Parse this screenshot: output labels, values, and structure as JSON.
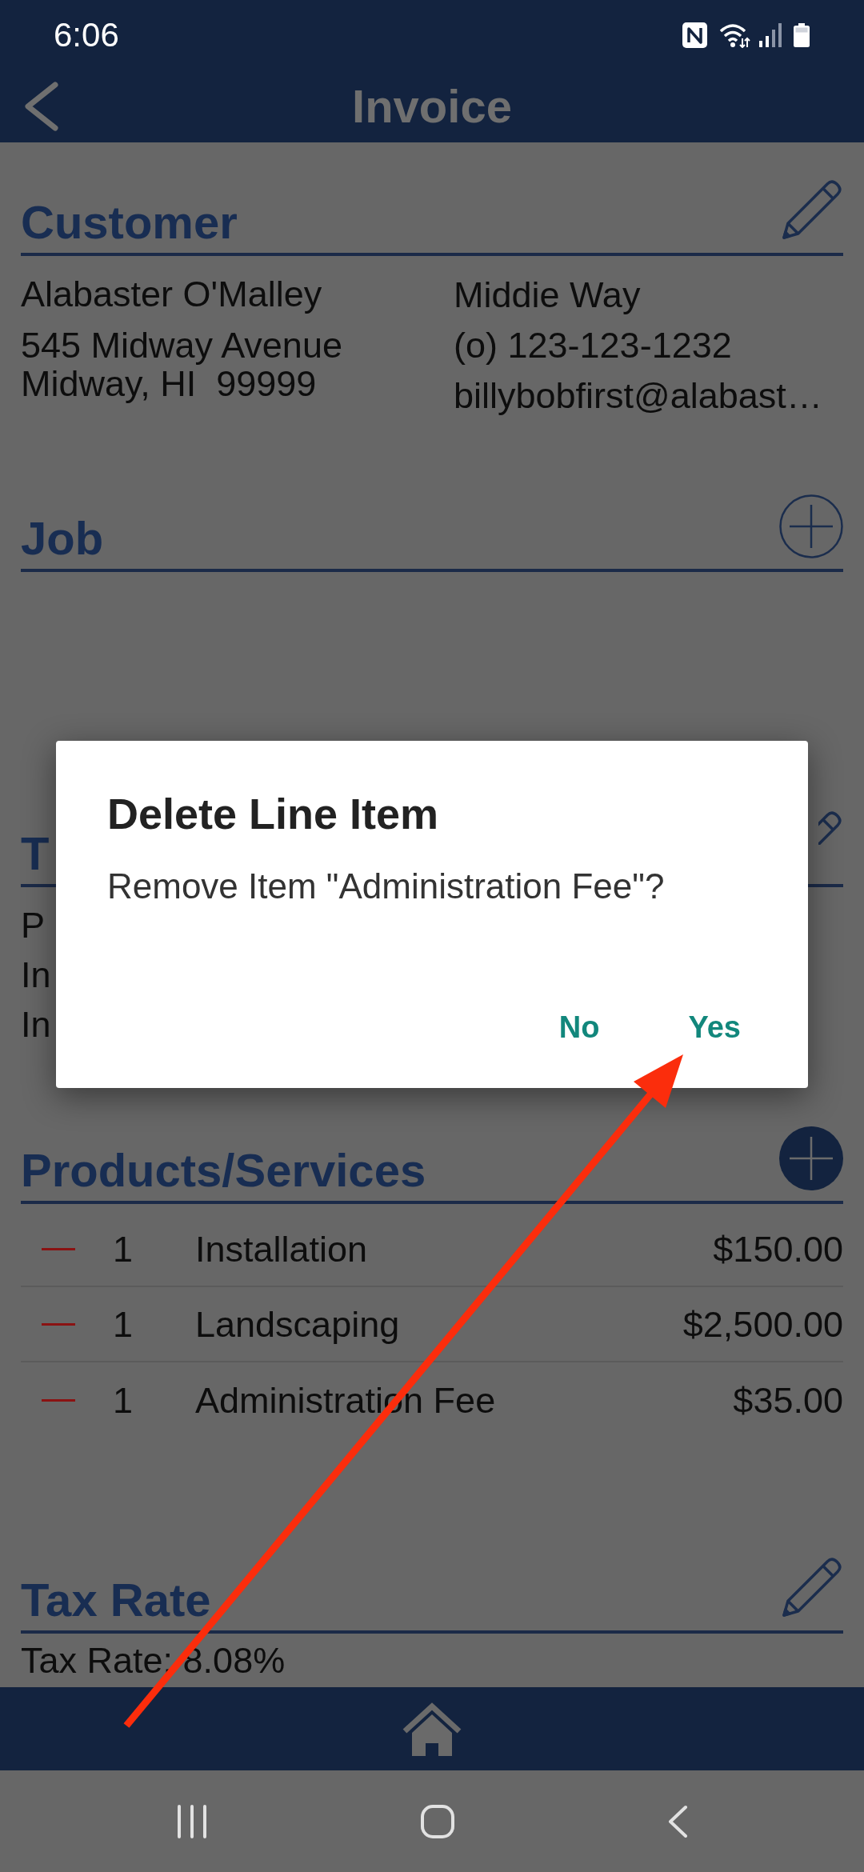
{
  "status_bar": {
    "time": "6:06"
  },
  "header": {
    "title": "Invoice"
  },
  "customer": {
    "title": "Customer",
    "name": "Alabaster O'Malley",
    "address": [
      "545 Midway Avenue",
      "Midway, HI  99999"
    ],
    "company": "Middie Way",
    "phone": "(o) 123-123-1232",
    "email": "billybobfirst@alabast…"
  },
  "job": {
    "title": "Job"
  },
  "section_3": {
    "title": "T",
    "lines": [
      "P",
      "In",
      "In"
    ]
  },
  "products": {
    "title": "Products/Services",
    "items": [
      {
        "quantity": "1",
        "name": "Installation",
        "price": "$150.00"
      },
      {
        "quantity": "1",
        "name": "Landscaping",
        "price": "$2,500.00"
      },
      {
        "quantity": "1",
        "name": "Administration Fee",
        "price": "$35.00"
      }
    ]
  },
  "tax_rate": {
    "title": "Tax Rate",
    "value": "Tax Rate: 8.08%"
  },
  "dialog": {
    "title": "Delete Line Item",
    "message": "Remove Item \"Administration Fee\"?",
    "buttons": [
      "No",
      "Yes"
    ]
  }
}
